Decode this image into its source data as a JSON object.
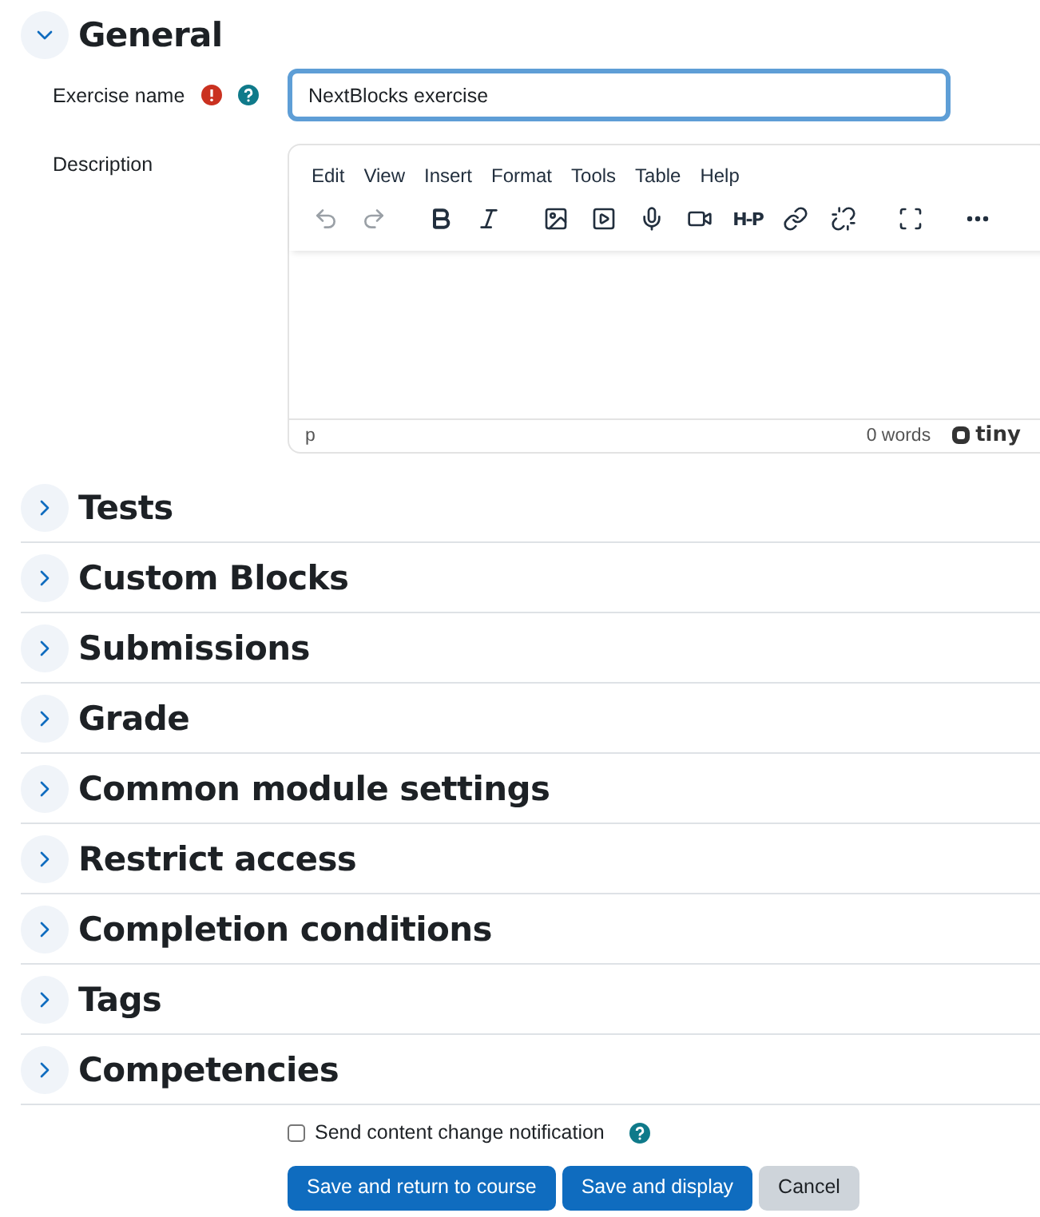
{
  "general": {
    "title": "General",
    "expanded": true
  },
  "fields": {
    "exercise_name": {
      "label": "Exercise name",
      "value": "NextBlocks exercise",
      "required": true
    },
    "description": {
      "label": "Description",
      "menu": [
        "Edit",
        "View",
        "Insert",
        "Format",
        "Tools",
        "Table",
        "Help"
      ],
      "h5p_label": "H-P",
      "path": "p",
      "word_count": "0 words",
      "brand": "tiny"
    }
  },
  "sections": [
    {
      "title": "Tests",
      "expanded": false
    },
    {
      "title": "Custom Blocks",
      "expanded": false
    },
    {
      "title": "Submissions",
      "expanded": false
    },
    {
      "title": "Grade",
      "expanded": false
    },
    {
      "title": "Common module settings",
      "expanded": false
    },
    {
      "title": "Restrict access",
      "expanded": false
    },
    {
      "title": "Completion conditions",
      "expanded": false
    },
    {
      "title": "Tags",
      "expanded": false
    },
    {
      "title": "Competencies",
      "expanded": false
    }
  ],
  "notification": {
    "label": "Send content change notification",
    "checked": false
  },
  "buttons": [
    {
      "label": "Save and return to course",
      "kind": "primary"
    },
    {
      "label": "Save and display",
      "kind": "primary"
    },
    {
      "label": "Cancel",
      "kind": "secondary"
    }
  ]
}
